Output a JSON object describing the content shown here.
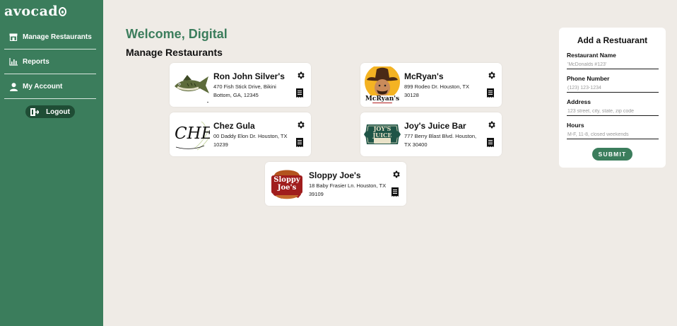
{
  "app": {
    "logo_text": "avocad"
  },
  "sidebar": {
    "items": [
      {
        "label": "Manage Restaurants",
        "icon": "storefront-icon"
      },
      {
        "label": "Reports",
        "icon": "bar-chart-icon"
      },
      {
        "label": "My Account",
        "icon": "user-icon"
      }
    ],
    "logout_label": "Logout"
  },
  "main": {
    "welcome": "Welcome, Digital",
    "section_title": "Manage Restaurants",
    "restaurants": [
      {
        "name": "Ron John Silver's",
        "address": "470 Fish Stick Drive, Bikini Bottom, GA, 12345",
        "logo": "fish-logo"
      },
      {
        "name": "McRyan's",
        "address": "899 Rodeo Dr. Houston, TX 30128",
        "logo": "cowboy-logo",
        "logo_text": "McRyan's"
      },
      {
        "name": "Chez Gula",
        "address": "00 Daddy Elon Dr. Houston, TX 10239",
        "logo": "chez-gula-logo",
        "logo_text": "CHEZ Gula"
      },
      {
        "name": "Joy's Juice Bar",
        "address": "777 Berry Blast Blvd. Houston, TX 30400",
        "logo": "juice-bar-logo",
        "logo_text": "JOY'S JUICE BAR"
      },
      {
        "name": "Sloppy Joe's",
        "address": "18 Baby Frasier Ln. Houston, TX 39109",
        "logo": "burger-logo",
        "logo_text": "Sloppy Joe's"
      }
    ]
  },
  "form": {
    "title": "Add a Restuarant",
    "fields": [
      {
        "label": "Restaurant Name",
        "placeholder": "'McDonalds #123'",
        "value": ""
      },
      {
        "label": "Phone Number",
        "placeholder": "(123) 123-1234",
        "value": ""
      },
      {
        "label": "Address",
        "placeholder": "123 street, city, state, zip code",
        "value": ""
      },
      {
        "label": "Hours",
        "placeholder": "M-F, 11-8, closed weekends",
        "value": ""
      }
    ],
    "submit_label": "SUBMIT"
  },
  "colors": {
    "primary": "#3b7d5c",
    "dark_green": "#1f4d35",
    "background": "#efebe6",
    "card": "#ffffff"
  }
}
